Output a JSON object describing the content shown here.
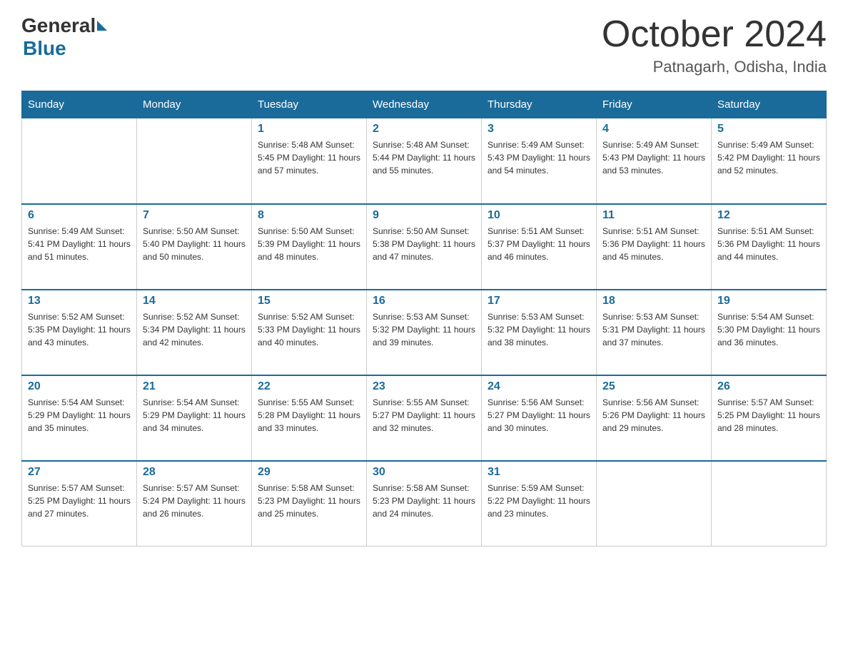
{
  "header": {
    "logo_general": "General",
    "logo_blue": "Blue",
    "month_title": "October 2024",
    "location": "Patnagarh, Odisha, India"
  },
  "days_of_week": [
    "Sunday",
    "Monday",
    "Tuesday",
    "Wednesday",
    "Thursday",
    "Friday",
    "Saturday"
  ],
  "weeks": [
    [
      {
        "day": "",
        "info": ""
      },
      {
        "day": "",
        "info": ""
      },
      {
        "day": "1",
        "info": "Sunrise: 5:48 AM\nSunset: 5:45 PM\nDaylight: 11 hours\nand 57 minutes."
      },
      {
        "day": "2",
        "info": "Sunrise: 5:48 AM\nSunset: 5:44 PM\nDaylight: 11 hours\nand 55 minutes."
      },
      {
        "day": "3",
        "info": "Sunrise: 5:49 AM\nSunset: 5:43 PM\nDaylight: 11 hours\nand 54 minutes."
      },
      {
        "day": "4",
        "info": "Sunrise: 5:49 AM\nSunset: 5:43 PM\nDaylight: 11 hours\nand 53 minutes."
      },
      {
        "day": "5",
        "info": "Sunrise: 5:49 AM\nSunset: 5:42 PM\nDaylight: 11 hours\nand 52 minutes."
      }
    ],
    [
      {
        "day": "6",
        "info": "Sunrise: 5:49 AM\nSunset: 5:41 PM\nDaylight: 11 hours\nand 51 minutes."
      },
      {
        "day": "7",
        "info": "Sunrise: 5:50 AM\nSunset: 5:40 PM\nDaylight: 11 hours\nand 50 minutes."
      },
      {
        "day": "8",
        "info": "Sunrise: 5:50 AM\nSunset: 5:39 PM\nDaylight: 11 hours\nand 48 minutes."
      },
      {
        "day": "9",
        "info": "Sunrise: 5:50 AM\nSunset: 5:38 PM\nDaylight: 11 hours\nand 47 minutes."
      },
      {
        "day": "10",
        "info": "Sunrise: 5:51 AM\nSunset: 5:37 PM\nDaylight: 11 hours\nand 46 minutes."
      },
      {
        "day": "11",
        "info": "Sunrise: 5:51 AM\nSunset: 5:36 PM\nDaylight: 11 hours\nand 45 minutes."
      },
      {
        "day": "12",
        "info": "Sunrise: 5:51 AM\nSunset: 5:36 PM\nDaylight: 11 hours\nand 44 minutes."
      }
    ],
    [
      {
        "day": "13",
        "info": "Sunrise: 5:52 AM\nSunset: 5:35 PM\nDaylight: 11 hours\nand 43 minutes."
      },
      {
        "day": "14",
        "info": "Sunrise: 5:52 AM\nSunset: 5:34 PM\nDaylight: 11 hours\nand 42 minutes."
      },
      {
        "day": "15",
        "info": "Sunrise: 5:52 AM\nSunset: 5:33 PM\nDaylight: 11 hours\nand 40 minutes."
      },
      {
        "day": "16",
        "info": "Sunrise: 5:53 AM\nSunset: 5:32 PM\nDaylight: 11 hours\nand 39 minutes."
      },
      {
        "day": "17",
        "info": "Sunrise: 5:53 AM\nSunset: 5:32 PM\nDaylight: 11 hours\nand 38 minutes."
      },
      {
        "day": "18",
        "info": "Sunrise: 5:53 AM\nSunset: 5:31 PM\nDaylight: 11 hours\nand 37 minutes."
      },
      {
        "day": "19",
        "info": "Sunrise: 5:54 AM\nSunset: 5:30 PM\nDaylight: 11 hours\nand 36 minutes."
      }
    ],
    [
      {
        "day": "20",
        "info": "Sunrise: 5:54 AM\nSunset: 5:29 PM\nDaylight: 11 hours\nand 35 minutes."
      },
      {
        "day": "21",
        "info": "Sunrise: 5:54 AM\nSunset: 5:29 PM\nDaylight: 11 hours\nand 34 minutes."
      },
      {
        "day": "22",
        "info": "Sunrise: 5:55 AM\nSunset: 5:28 PM\nDaylight: 11 hours\nand 33 minutes."
      },
      {
        "day": "23",
        "info": "Sunrise: 5:55 AM\nSunset: 5:27 PM\nDaylight: 11 hours\nand 32 minutes."
      },
      {
        "day": "24",
        "info": "Sunrise: 5:56 AM\nSunset: 5:27 PM\nDaylight: 11 hours\nand 30 minutes."
      },
      {
        "day": "25",
        "info": "Sunrise: 5:56 AM\nSunset: 5:26 PM\nDaylight: 11 hours\nand 29 minutes."
      },
      {
        "day": "26",
        "info": "Sunrise: 5:57 AM\nSunset: 5:25 PM\nDaylight: 11 hours\nand 28 minutes."
      }
    ],
    [
      {
        "day": "27",
        "info": "Sunrise: 5:57 AM\nSunset: 5:25 PM\nDaylight: 11 hours\nand 27 minutes."
      },
      {
        "day": "28",
        "info": "Sunrise: 5:57 AM\nSunset: 5:24 PM\nDaylight: 11 hours\nand 26 minutes."
      },
      {
        "day": "29",
        "info": "Sunrise: 5:58 AM\nSunset: 5:23 PM\nDaylight: 11 hours\nand 25 minutes."
      },
      {
        "day": "30",
        "info": "Sunrise: 5:58 AM\nSunset: 5:23 PM\nDaylight: 11 hours\nand 24 minutes."
      },
      {
        "day": "31",
        "info": "Sunrise: 5:59 AM\nSunset: 5:22 PM\nDaylight: 11 hours\nand 23 minutes."
      },
      {
        "day": "",
        "info": ""
      },
      {
        "day": "",
        "info": ""
      }
    ]
  ]
}
